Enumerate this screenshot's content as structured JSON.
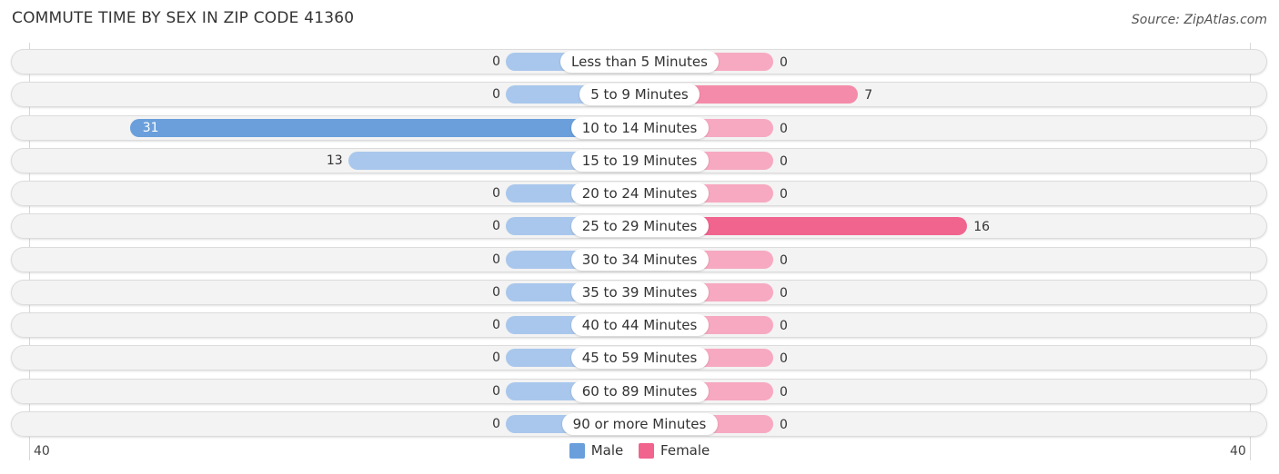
{
  "title": "COMMUTE TIME BY SEX IN ZIP CODE 41360",
  "source": "Source: ZipAtlas.com",
  "colors": {
    "male": "#6a9fdb",
    "female": "#f0648e"
  },
  "chart_data": {
    "type": "bar",
    "orientation": "horizontal-diverging",
    "title": "COMMUTE TIME BY SEX IN ZIP CODE 41360",
    "categories": [
      "Less than 5 Minutes",
      "5 to 9 Minutes",
      "10 to 14 Minutes",
      "15 to 19 Minutes",
      "20 to 24 Minutes",
      "25 to 29 Minutes",
      "30 to 34 Minutes",
      "35 to 39 Minutes",
      "40 to 44 Minutes",
      "45 to 59 Minutes",
      "60 to 89 Minutes",
      "90 or more Minutes"
    ],
    "series": [
      {
        "name": "Male",
        "values": [
          0,
          0,
          31,
          13,
          0,
          0,
          0,
          0,
          0,
          0,
          0,
          0
        ]
      },
      {
        "name": "Female",
        "values": [
          0,
          7,
          0,
          0,
          0,
          16,
          0,
          0,
          0,
          0,
          0,
          0
        ]
      }
    ],
    "axis_left_label": "40",
    "axis_right_label": "40",
    "xlim": [
      -40,
      40
    ],
    "legend": [
      "Male",
      "Female"
    ],
    "legend_position": "bottom-center"
  }
}
